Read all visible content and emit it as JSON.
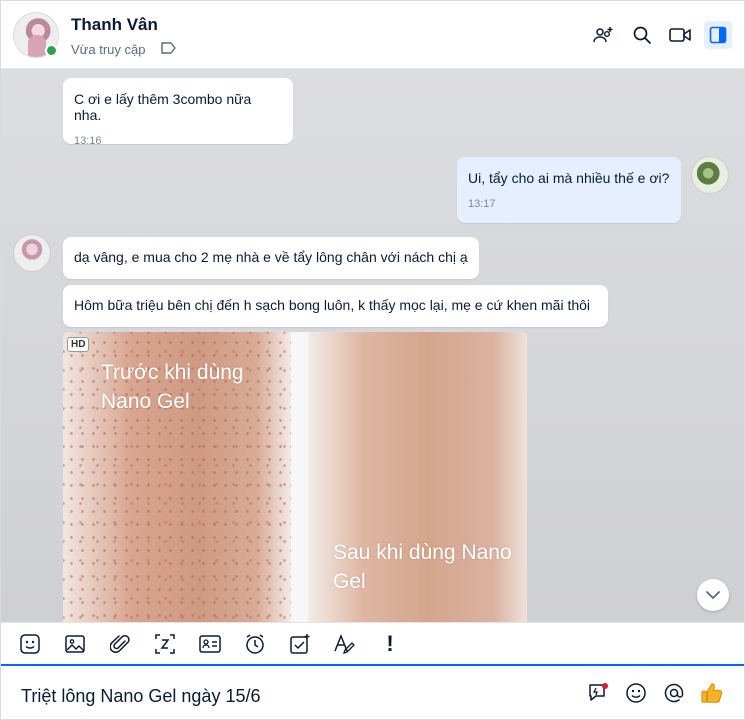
{
  "header": {
    "contact_name": "Thanh Vân",
    "status": "Vừa truy cập",
    "icons": [
      "add-group-icon",
      "search-icon",
      "video-call-icon",
      "sidebar-toggle-icon"
    ]
  },
  "messages": [
    {
      "from": "contact",
      "text": "C ơi e lấy thêm 3combo nữa nha.",
      "time": "13:16"
    },
    {
      "from": "me",
      "text": "Ui, tẩy cho ai mà nhiều thế e ơi?",
      "time": "13:17"
    },
    {
      "from": "contact",
      "text": "dạ vâng, e mua cho 2 mẹ nhà e về tẩy lông chân với nách chị ạ"
    },
    {
      "from": "contact",
      "text": "Hôm bữa triệu bên chị đến h sạch bong luôn, k thấy mọc lại, mẹ e cứ khen mãi thôi"
    }
  ],
  "photo": {
    "badge": "HD",
    "caption_before": "Trước khi dùng Nano Gel",
    "caption_after": "Sau khi dùng Nano Gel"
  },
  "toolbar": {
    "icons": [
      "sticker-icon",
      "image-icon",
      "attachment-icon",
      "screenshot-icon",
      "contact-card-icon",
      "reminder-icon",
      "task-icon",
      "text-format-icon",
      "urgent-icon"
    ],
    "urgent_label": "!"
  },
  "composer": {
    "value": "Triệt lông Nano Gel ngày 15/6",
    "icons": [
      "quick-reply-icon",
      "emoji-icon",
      "mention-icon",
      "like-icon"
    ]
  },
  "colors": {
    "accent": "#0068ff",
    "my_bubble": "#e5efff",
    "chat_bg": "#d6d7db",
    "online": "#30a14e"
  }
}
